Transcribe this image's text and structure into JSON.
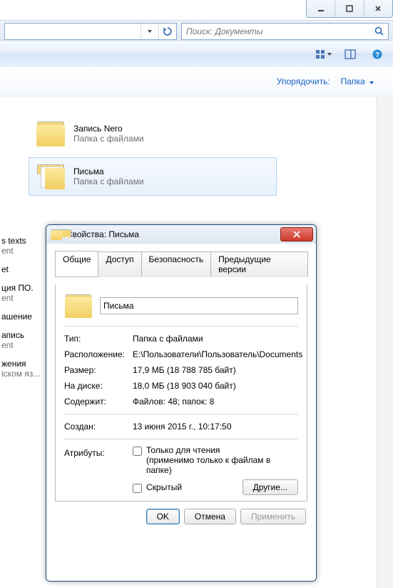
{
  "search": {
    "placeholder": "Поиск: Документы"
  },
  "organize": {
    "label": "Упорядочить:",
    "popup": "Папка"
  },
  "items": [
    {
      "name": "Запись Nero",
      "type": "Папка с файлами"
    },
    {
      "name": "Письма",
      "type": "Папка с файлами"
    }
  ],
  "side": [
    {
      "h": "s texts",
      "s": "ent"
    },
    {
      "h": "et",
      "s": ""
    },
    {
      "h": "ция ПО.",
      "s": "ent"
    },
    {
      "h": "ашение",
      "s": ""
    },
    {
      "h": "апись",
      "s": "ent"
    },
    {
      "h": "жения",
      "s": "іском яз..."
    }
  ],
  "dialog": {
    "title": "Свойства: Письма",
    "tabs": [
      "Общие",
      "Доступ",
      "Безопасность",
      "Предыдущие версии"
    ],
    "name_value": "Письма",
    "rows": {
      "type_k": "Тип:",
      "type_v": "Папка с файлами",
      "loc_k": "Расположение:",
      "loc_v": "E:\\Пользователи\\Пользователь\\Documents",
      "size_k": "Размер:",
      "size_v": "17,9 МБ (18 788 785 байт)",
      "disk_k": "На диске:",
      "disk_v": "18,0 МБ (18 903 040 байт)",
      "cont_k": "Содержит:",
      "cont_v": "Файлов: 48; папок: 8",
      "crt_k": "Создан:",
      "crt_v": "13 июня 2015 г., 10:17:50",
      "attr_k": "Атрибуты:"
    },
    "readonly_label": "Только для чтения",
    "readonly_sub": "(применимо только к файлам в папке)",
    "hidden_label": "Скрытый",
    "other_btn": "Другие...",
    "ok": "OK",
    "cancel": "Отмена",
    "apply": "Применить"
  }
}
